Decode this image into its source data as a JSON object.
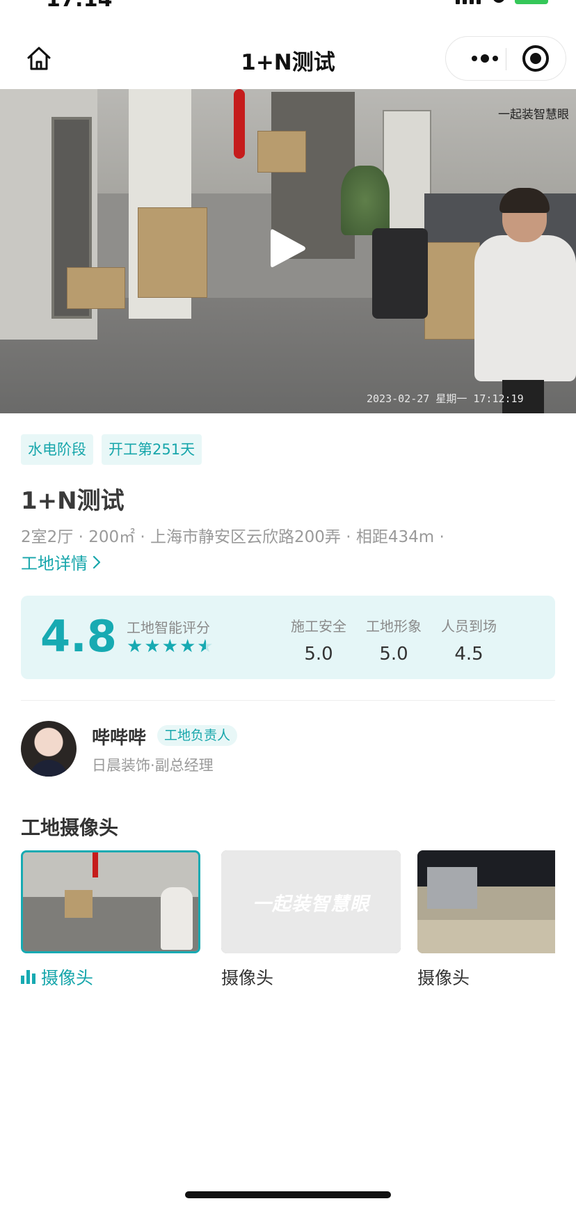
{
  "status_bar": {
    "time": "17:14"
  },
  "nav": {
    "title": "1+N测试"
  },
  "video": {
    "watermark": "一起装智慧眼",
    "timestamp": "2023-02-27 星期一 17:12:19"
  },
  "site": {
    "tags": [
      "水电阶段",
      "开工第251天"
    ],
    "title": "1+N测试",
    "meta": "2室2厅 · 200㎡ · 上海市静安区云欣路200弄 · 相距434m ·",
    "detail_link": "工地详情"
  },
  "score": {
    "value": "4.8",
    "label": "工地智能评分",
    "stars": 4.5,
    "items": [
      {
        "label": "施工安全",
        "value": "5.0"
      },
      {
        "label": "工地形象",
        "value": "5.0"
      },
      {
        "label": "人员到场",
        "value": "4.5"
      }
    ]
  },
  "manager": {
    "name": "哔哔哔",
    "role": "工地负责人",
    "company": "日晨装饰·副总经理"
  },
  "cameras": {
    "heading": "工地摄像头",
    "items": [
      {
        "label": "摄像头",
        "active": true
      },
      {
        "label": "摄像头",
        "placeholder": "一起装智慧眼"
      },
      {
        "label": "摄像头"
      }
    ]
  },
  "colors": {
    "accent": "#17aab2",
    "tag_bg": "#e8f7f7",
    "card_bg": "#e5f6f7"
  }
}
